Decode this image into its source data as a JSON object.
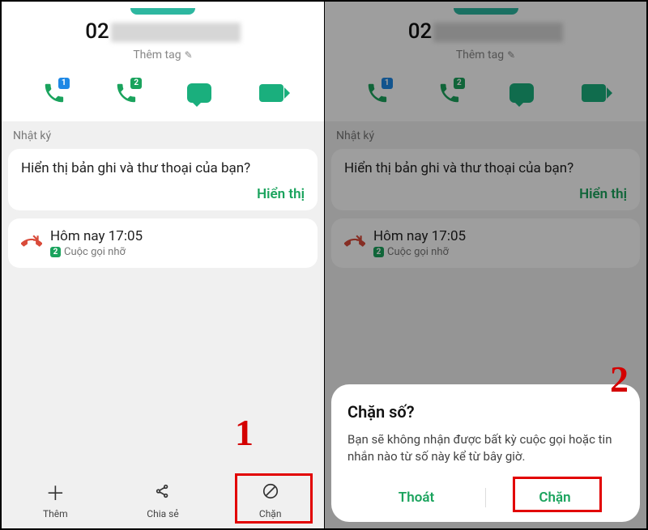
{
  "contact": {
    "number_prefix": "02",
    "add_tag_label": "Thêm tag"
  },
  "actions": {
    "sim1_badge": "1",
    "sim2_badge": "2"
  },
  "recents": {
    "header": "Nhật ký",
    "voicemail_prompt": "Hiển thị bản ghi và thư thoại của bạn?",
    "voicemail_action": "Hiển thị",
    "call_time": "Hôm nay 17:05",
    "call_sim_badge": "2",
    "call_type": "Cuộc gọi nhỡ"
  },
  "bottom": {
    "add": "Thêm",
    "share": "Chia sẻ",
    "block": "Chặn"
  },
  "modal": {
    "title": "Chặn số?",
    "body": "Bạn sẽ không nhận được bất kỳ cuộc gọi hoặc tin nhắn nào từ số này kể từ bây giờ.",
    "cancel": "Thoát",
    "confirm": "Chặn"
  },
  "step1": "1",
  "step2": "2"
}
